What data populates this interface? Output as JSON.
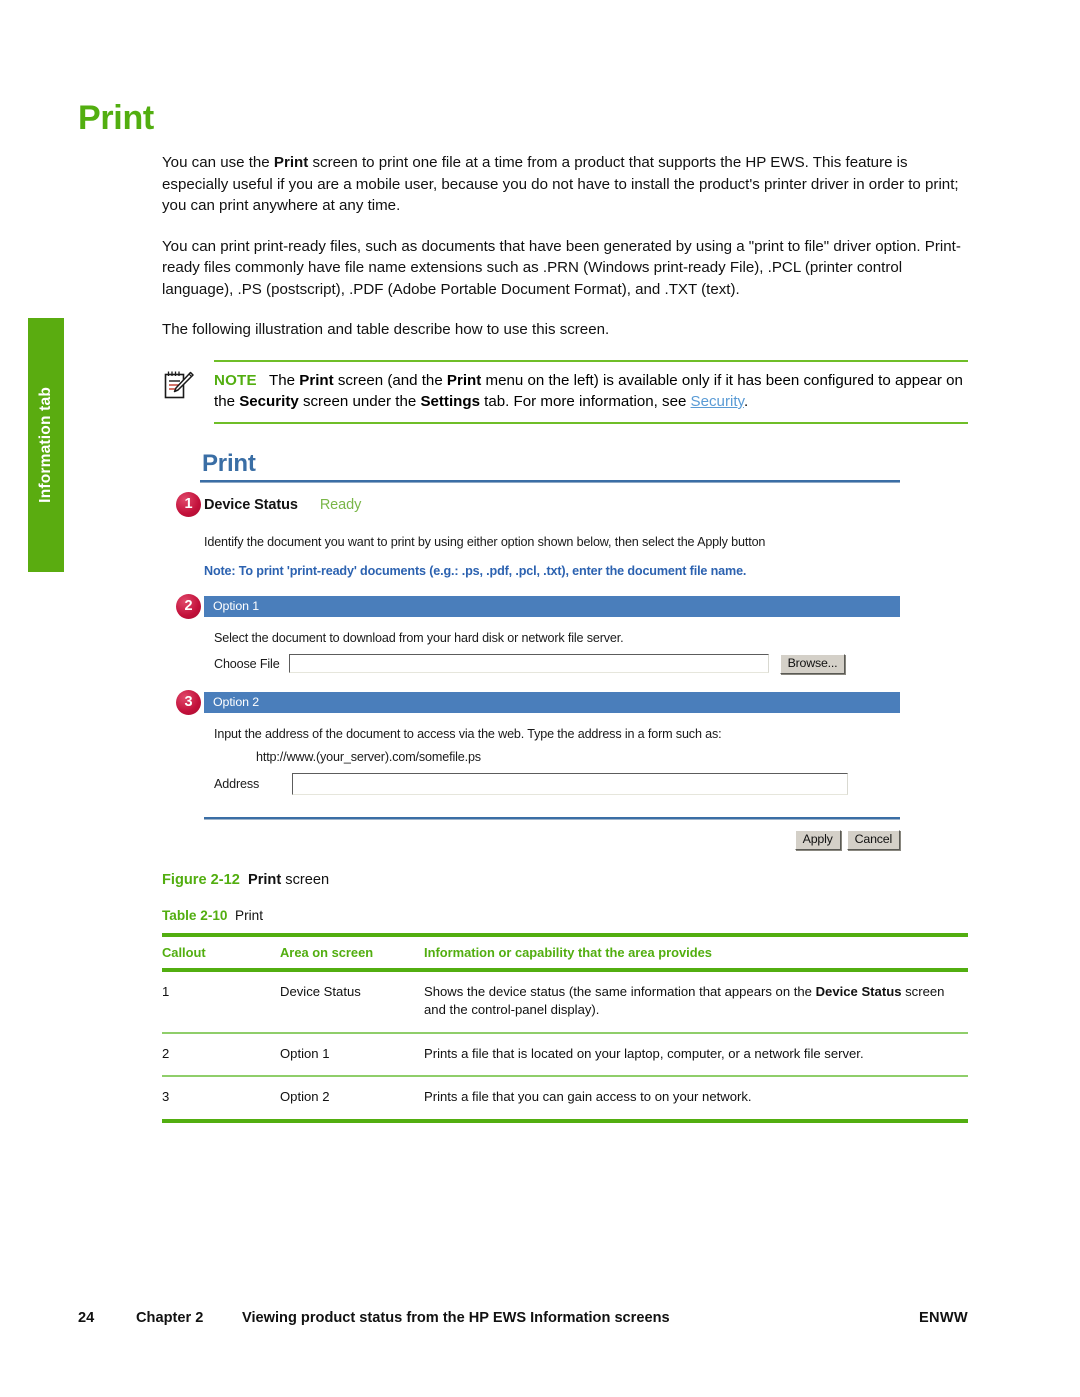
{
  "sidebar": {
    "tab_label": "Information tab",
    "color": "#5aac10"
  },
  "page": {
    "title": "Print",
    "title_color": "#52ae10",
    "paragraphs": [
      "You can use the Print screen to print one file at a time from a product that supports the HP EWS. This feature is especially useful if you are a mobile user, because you do not have to install the product's printer driver in order to print; you can print anywhere at any time.",
      "You can print print-ready files, such as documents that have been generated by using a \"print to file\" driver option. Print-ready files commonly have file name extensions such as .PRN (Windows print-ready File), .PCL (printer control language), .PS (postscript), .PDF (Adobe Portable Document Format), and .TXT (text).",
      "The following illustration and table describe how to use this screen."
    ]
  },
  "note": {
    "icon": "note-pencil-icon",
    "label": "NOTE",
    "text_before_link": "The Print screen (and the Print menu on the left) is available only if it has been configured to appear on the Security screen under the Settings tab. For more information, see ",
    "link_text": "Security",
    "text_after_link": ".",
    "rule_color": "#6fbe28"
  },
  "ews": {
    "title": "Print",
    "accent_color": "#3a6ea5",
    "callouts": {
      "one": "1",
      "two": "2",
      "three": "3"
    },
    "device_status": {
      "label": "Device Status",
      "value": "Ready",
      "value_color": "#7ab648"
    },
    "instruction": "Identify the document you want to print by using either option shown below, then select the Apply button",
    "note_line": "Note: To print 'print-ready' documents (e.g.: .ps, .pdf, .pcl, .txt), enter the document file name.",
    "option1": {
      "header": "Option 1",
      "description": "Select the document to download from your hard disk or network file server.",
      "field_label": "Choose File",
      "field_value": "",
      "browse_label": "Browse..."
    },
    "option2": {
      "header": "Option 2",
      "description": "Input the address of the document to access via the web. Type the address in a form such as:",
      "url_sample": "http://www.(your_server).com/somefile.ps",
      "field_label": "Address",
      "field_value": ""
    },
    "apply_label": "Apply",
    "cancel_label": "Cancel",
    "option_bar_color": "#4a7ebb"
  },
  "figure_caption": {
    "lead": "Figure 2-12",
    "bold_word": "Print",
    "rest": " screen"
  },
  "table_caption": {
    "lead": "Table 2-10",
    "rest": "Print"
  },
  "table": {
    "headers": [
      "Callout",
      "Area on screen",
      "Information or capability that the area provides"
    ],
    "rows": [
      {
        "callout": "1",
        "area": "Device Status",
        "info_a": "Shows the device status (the same information that appears on the ",
        "info_b": "Device Status",
        "info_c": " screen and the control-panel display)."
      },
      {
        "callout": "2",
        "area": "Option 1",
        "info_a": "Prints a file that is located on your laptop, computer, or a network file server.",
        "info_b": "",
        "info_c": ""
      },
      {
        "callout": "3",
        "area": "Option 2",
        "info_a": "Prints a file that you can gain access to on your network.",
        "info_b": "",
        "info_c": ""
      }
    ],
    "header_color": "#52ae10"
  },
  "footer": {
    "page_number": "24",
    "chapter": "Chapter 2",
    "title": "Viewing product status from the HP EWS Information screens",
    "locale": "ENWW"
  }
}
